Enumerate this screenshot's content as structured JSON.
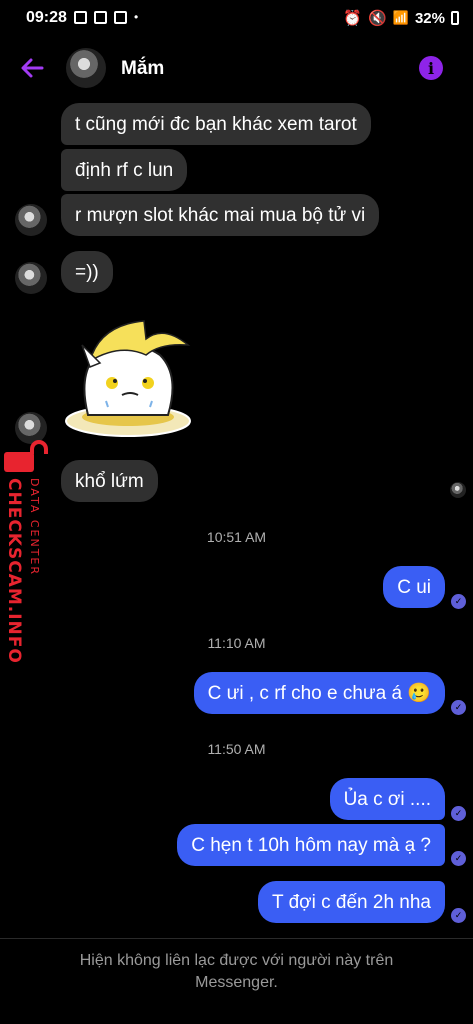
{
  "status_bar": {
    "time": "09:28",
    "battery": "32%"
  },
  "header": {
    "contact_name": "Mắm"
  },
  "messages_in": [
    {
      "text": "t cũng mới đc bạn khác xem tarot"
    },
    {
      "text": "định rf c lun"
    },
    {
      "text": "r mượn slot khác mai mua bộ tử vi"
    },
    {
      "text": "=))"
    },
    {
      "text": "khổ lứm"
    }
  ],
  "timestamps": [
    "10:51 AM",
    "11:10 AM",
    "11:50 AM"
  ],
  "messages_out": [
    {
      "text": "C ui"
    },
    {
      "text": "C ưi , c rf cho e chưa á 🥲"
    },
    {
      "text": "Ủa c ơi ...."
    },
    {
      "text": "C hẹn t 10h hôm nay mà ạ ?"
    },
    {
      "text": "T đợi c đến 2h nha"
    }
  ],
  "watermark": {
    "main": "CHECKSCAM.INFO",
    "sub": "DATA CENTER"
  },
  "footer": {
    "line1": "Hiện không liên lạc được với người này trên",
    "line2": "Messenger."
  },
  "colors": {
    "outgoing": "#3a5ef4",
    "incoming": "#303030",
    "accent": "#8e24e8",
    "watermark": "#e8242f"
  }
}
